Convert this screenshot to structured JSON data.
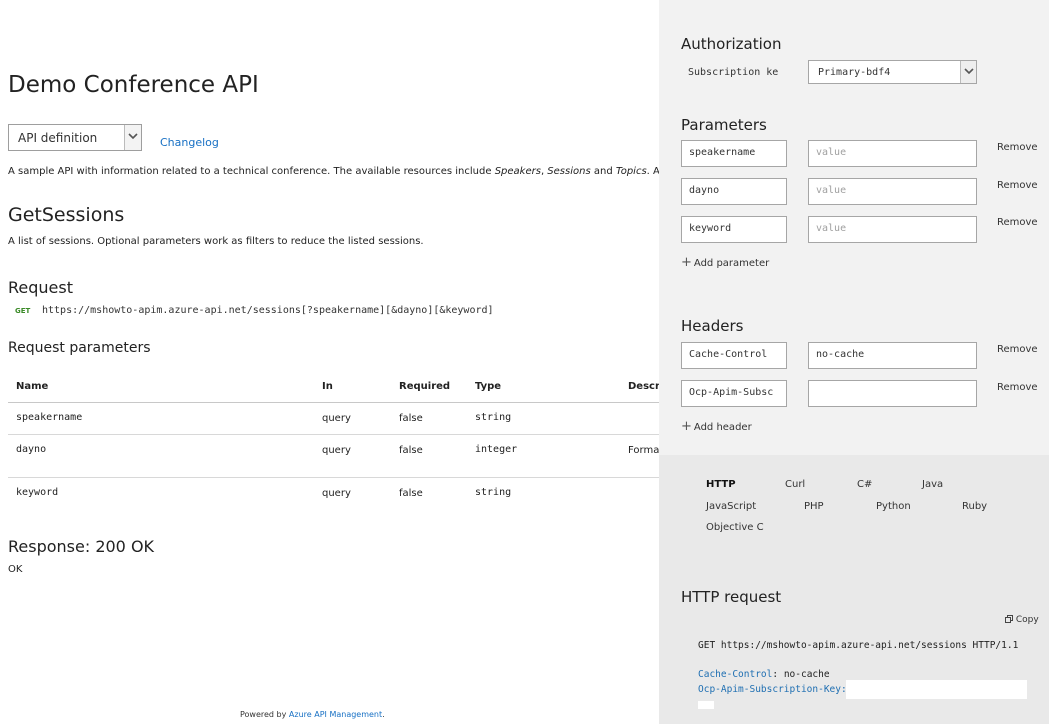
{
  "api": {
    "title": "Demo Conference API",
    "definition_select": "API definition",
    "changelog": "Changelog",
    "description": "A sample API with information related to a technical conference. The available resources include Speakers, Sessions and Topics. A single write ope"
  },
  "operation": {
    "title": "GetSessions",
    "description": "A list of sessions. Optional parameters work as filters to reduce the listed sessions.",
    "request_heading": "Request",
    "method": "GET",
    "url": "https://mshowto-apim.azure-api.net/sessions[?speakername][&dayno][&keyword]",
    "params_heading": "Request parameters",
    "table": {
      "headers": [
        "Name",
        "In",
        "Required",
        "Type",
        "Descri"
      ],
      "rows": [
        {
          "name": "speakername",
          "in": "query",
          "required": "false",
          "type": "string",
          "desc": ""
        },
        {
          "name": "dayno",
          "in": "query",
          "required": "false",
          "type": "integer",
          "desc": "Format"
        },
        {
          "name": "keyword",
          "in": "query",
          "required": "false",
          "type": "string",
          "desc": ""
        }
      ]
    },
    "response_heading": "Response: 200 OK",
    "response_text": "OK"
  },
  "footer": {
    "prefix": "Powered by",
    "link": "Azure API Management",
    "suffix": "."
  },
  "console": {
    "auth": {
      "title": "Authorization",
      "label": "Subscription ke",
      "key_value": "Primary-bdf4"
    },
    "params": {
      "title": "Parameters",
      "items": [
        {
          "name": "speakername",
          "value_placeholder": "value"
        },
        {
          "name": "dayno",
          "value_placeholder": "value"
        },
        {
          "name": "keyword",
          "value_placeholder": "value"
        }
      ],
      "remove_label": "Remove",
      "add_label": "Add parameter"
    },
    "headers": {
      "title": "Headers",
      "items": [
        {
          "name": "Cache-Control",
          "value": "no-cache"
        },
        {
          "name": "Ocp-Apim-Subsc",
          "value": ""
        }
      ],
      "add_label": "Add header"
    },
    "languages": [
      "HTTP",
      "Curl",
      "C#",
      "Java",
      "JavaScript",
      "PHP",
      "Python",
      "Ruby",
      "Objective C"
    ],
    "active_language": "HTTP",
    "http_request": {
      "title": "HTTP request",
      "copy_label": "Copy",
      "request_line": "GET https://mshowto-apim.azure-api.net/sessions HTTP/1.1",
      "headers": [
        {
          "key": "Cache-Control",
          "value": "no-cache"
        },
        {
          "key": "Ocp-Apim-Subscription-Key",
          "value": ""
        }
      ]
    }
  }
}
